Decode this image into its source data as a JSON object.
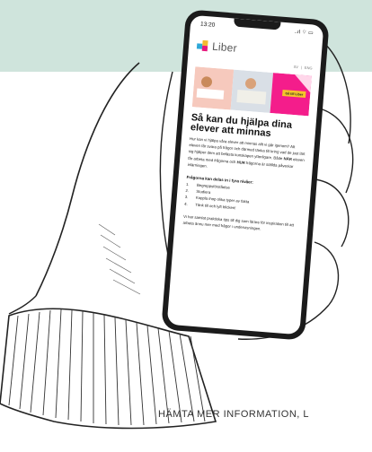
{
  "phone": {
    "time": "13:20",
    "status_icons": "..ıl ⌔ ▭",
    "brand": "Liber",
    "lang": [
      "SV",
      "|",
      "ENG"
    ],
    "hero_button": "Gå till Liber",
    "headline": "Så kan du hjälpa dina elever att minnas",
    "intro_parts": [
      "Hur kan vi hjälpa våra elever att minnas allt vi går igenom? Att eleven får svara på frågor och därmed tänka till kring vad de just lärt sig hjälper dem att befästa kunskapen ytterligare. Både ",
      "NÄR",
      " eleven får arbeta med frågorna och ",
      "HUR",
      " frågorna är ställda påverkar inlärningen."
    ],
    "list_title": "Frågorna kan delas in i fyra nivåer:",
    "list": [
      {
        "n": "1.",
        "t": "Begreppsförståelse"
      },
      {
        "n": "2.",
        "t": "Studiera"
      },
      {
        "n": "3.",
        "t": "Koppla ihop olika typer av fakta"
      },
      {
        "n": "4.",
        "t": "Tänk till och lyft blicken!"
      }
    ],
    "outro": "Vi har samlat praktiska tips till dig som lärare för inspiration till att arbeta ännu mer med frågor i undervisningen."
  },
  "footer": {
    "text": "HÄMTA MER INFORMATION, L"
  },
  "colors": {
    "mint": "#cfe4dc",
    "pink": "#f41d8b",
    "yellow": "#f5c52b",
    "blue": "#2ea8d8"
  }
}
